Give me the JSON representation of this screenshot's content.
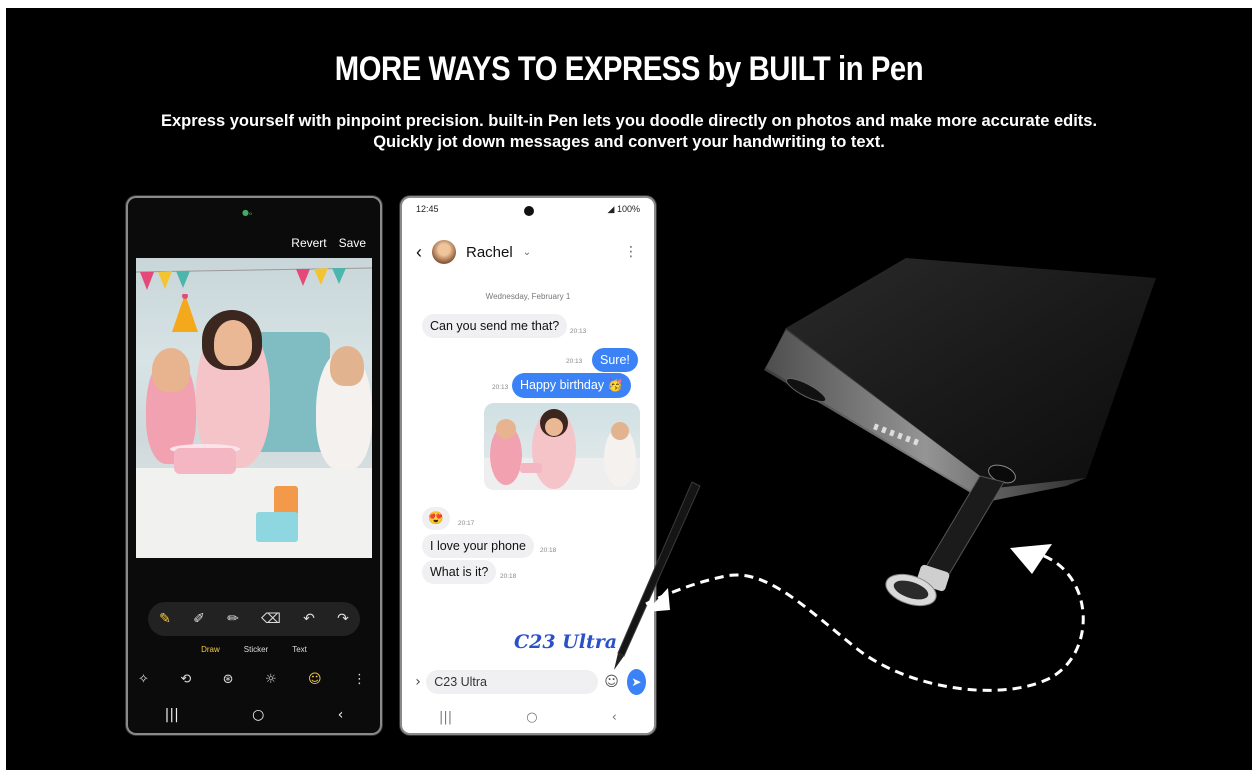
{
  "headline": "MORE WAYS TO EXPRESS by BUILT in Pen",
  "subtitle": {
    "line1": "Express yourself with pinpoint precision. built-in Pen lets you doodle directly on photos and make more accurate edits.",
    "line2": "Quickly jot down messages and convert your handwriting to text."
  },
  "editor": {
    "revert_label": "Revert",
    "save_label": "Save",
    "modes": [
      "Draw",
      "Sticker",
      "Text"
    ],
    "active_mode": "Draw"
  },
  "messages": {
    "status_time": "12:45",
    "status_right": "100%",
    "contact_name": "Rachel",
    "date_label": "Wednesday, February 1",
    "items": [
      {
        "text": "Can you send me that?",
        "time": "20:13"
      },
      {
        "text": "Sure!",
        "time": "20:13"
      },
      {
        "text": "Happy birthday 🥳",
        "time": "20:13"
      },
      {
        "text": "😍",
        "time": "20:17"
      },
      {
        "text": "I love your phone",
        "time": "20:18"
      },
      {
        "text": "What is it?",
        "time": "20:18"
      }
    ],
    "handwriting": "C23 Ultra",
    "input_value": "C23 Ultra"
  },
  "colors": {
    "accent_blue": "#3b82f6",
    "draw_yellow": "#f7c948",
    "background": "#000000"
  }
}
